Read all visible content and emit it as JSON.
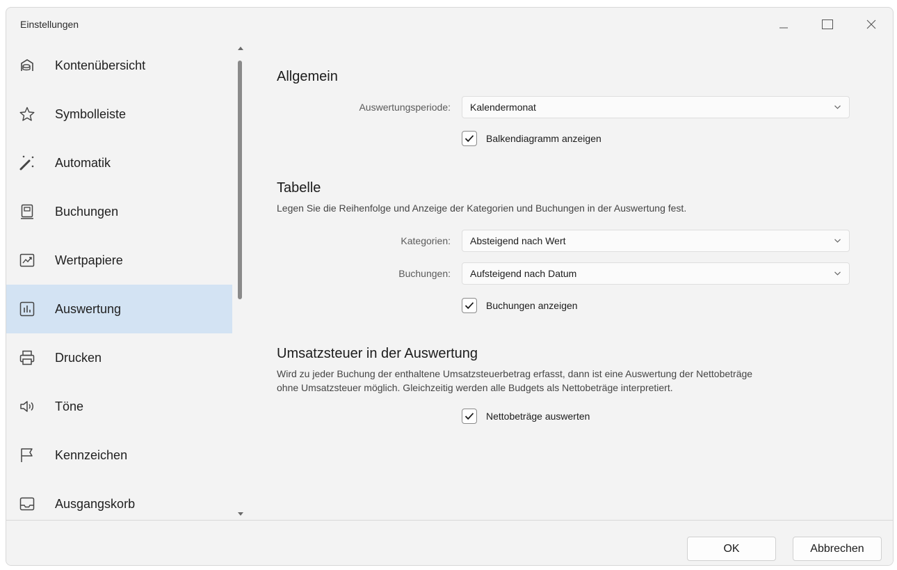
{
  "window": {
    "title": "Einstellungen"
  },
  "sidebar": {
    "items": [
      {
        "label": "Kontenübersicht",
        "icon": "piggy-bank-icon"
      },
      {
        "label": "Symbolleiste",
        "icon": "star-icon"
      },
      {
        "label": "Automatik",
        "icon": "magic-wand-icon"
      },
      {
        "label": "Buchungen",
        "icon": "receipt-icon"
      },
      {
        "label": "Wertpapiere",
        "icon": "chart-trend-icon"
      },
      {
        "label": "Auswertung",
        "icon": "bar-chart-icon",
        "active": true
      },
      {
        "label": "Drucken",
        "icon": "printer-icon"
      },
      {
        "label": "Töne",
        "icon": "speaker-icon"
      },
      {
        "label": "Kennzeichen",
        "icon": "flag-icon"
      },
      {
        "label": "Ausgangskorb",
        "icon": "outbox-tray-icon"
      }
    ]
  },
  "general": {
    "heading": "Allgemein",
    "period_label": "Auswertungsperiode:",
    "period_value": "Kalendermonat",
    "bar_chart_checkbox": "Balkendiagramm anzeigen",
    "bar_chart_checked": true
  },
  "table": {
    "heading": "Tabelle",
    "description": "Legen Sie die Reihenfolge und Anzeige der Kategorien und Buchungen in der Auswertung fest.",
    "categories_label": "Kategorien:",
    "categories_value": "Absteigend nach Wert",
    "bookings_label": "Buchungen:",
    "bookings_value": "Aufsteigend nach Datum",
    "show_bookings_checkbox": "Buchungen anzeigen",
    "show_bookings_checked": true
  },
  "vat": {
    "heading": "Umsatzsteuer in der Auswertung",
    "description_line1": "Wird zu jeder Buchung der enthaltene Umsatzsteuerbetrag erfasst, dann ist eine Auswertung der Nettobeträge",
    "description_line2": "ohne Umsatzsteuer möglich. Gleichzeitig werden alle Budgets als Nettobeträge interpretiert.",
    "net_checkbox": "Nettobeträge auswerten",
    "net_checked": true
  },
  "footer": {
    "ok_label": "OK",
    "cancel_label": "Abbrechen"
  },
  "colors": {
    "active_nav": "#d3e3f3",
    "window_bg": "#f3f3f3"
  }
}
